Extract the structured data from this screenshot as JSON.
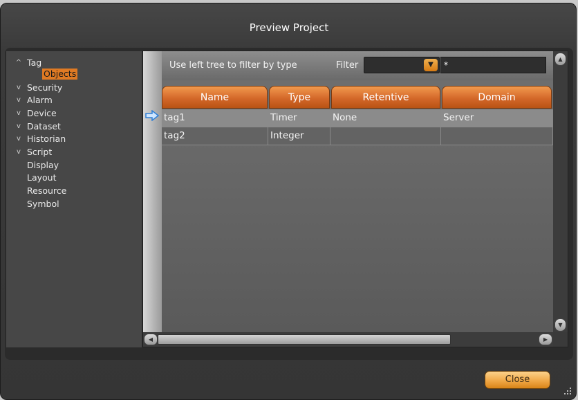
{
  "window": {
    "title": "Preview Project"
  },
  "tree": {
    "items": [
      {
        "label": "Tag",
        "arrow": "^"
      },
      {
        "label": "Objects",
        "arrow": ""
      },
      {
        "label": "Security",
        "arrow": "v"
      },
      {
        "label": "Alarm",
        "arrow": "v"
      },
      {
        "label": "Device",
        "arrow": "v"
      },
      {
        "label": "Dataset",
        "arrow": "v"
      },
      {
        "label": "Historian",
        "arrow": "v"
      },
      {
        "label": "Script",
        "arrow": "v"
      },
      {
        "label": "Display",
        "arrow": ""
      },
      {
        "label": "Layout",
        "arrow": ""
      },
      {
        "label": "Resource",
        "arrow": ""
      },
      {
        "label": "Symbol",
        "arrow": ""
      }
    ],
    "selected": "Objects"
  },
  "filter": {
    "hint": "Use left tree to filter by type",
    "label": "Filter",
    "select_value": "",
    "text_value": "*"
  },
  "table": {
    "columns": [
      "Name",
      "Type",
      "Retentive",
      "Domain"
    ],
    "rows": [
      [
        "tag1",
        "Timer",
        "None",
        "Server"
      ],
      [
        "tag2",
        "Integer",
        "",
        ""
      ]
    ]
  },
  "buttons": {
    "close": "Close"
  },
  "colors": {
    "accent": "#e07a23",
    "header_orange": "#d4682a",
    "selected_row": "#8b8b8b"
  }
}
